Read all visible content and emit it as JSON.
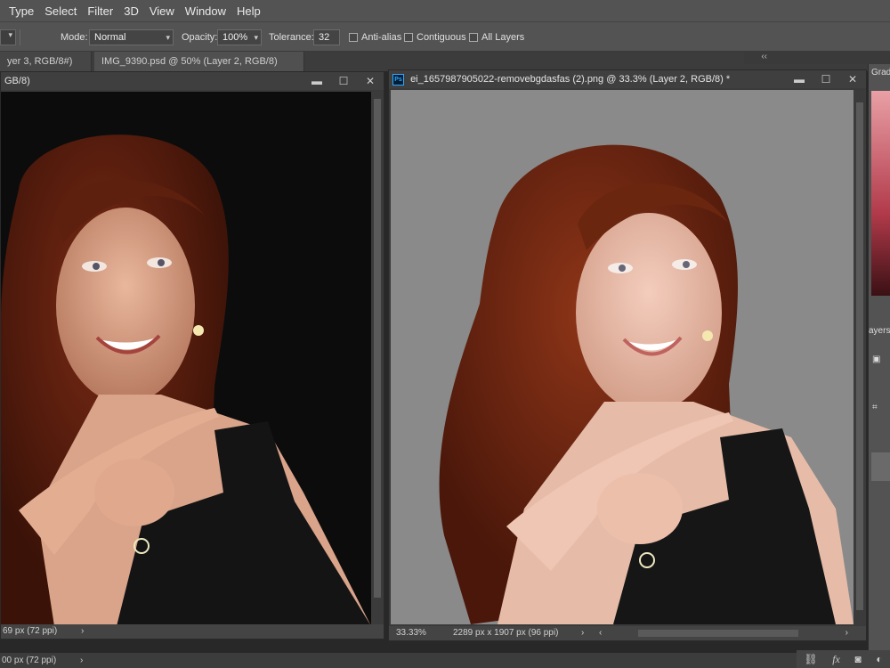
{
  "menu": [
    "Type",
    "Select",
    "Filter",
    "3D",
    "View",
    "Window",
    "Help"
  ],
  "options": {
    "mode_label": "Mode:",
    "mode_value": "Normal",
    "opacity_label": "Opacity:",
    "opacity_value": "100%",
    "tolerance_label": "Tolerance:",
    "tolerance_value": "32",
    "antialias": "Anti-alias",
    "contiguous": "Contiguous",
    "all_layers": "All Layers"
  },
  "tabs": [
    {
      "label": "yer 3, RGB/8#) *"
    },
    {
      "label": "IMG_9390.psd @ 50% (Layer 2, RGB/8) *"
    }
  ],
  "left_window": {
    "title": "GB/8)",
    "status": "69 px (72 ppi)"
  },
  "right_window": {
    "title": "ei_1657987905022-removebgdasfas (2).png @ 33.3% (Layer 2, RGB/8) *",
    "zoom": "33.33%",
    "status": "2289 px x 1907 px (96 ppi)"
  },
  "bottom_status": "00 px (72 ppi)",
  "panel": {
    "grad_label": "Grad",
    "layers_label": "ayers"
  },
  "colors": {
    "accent_ps": "#31a8ff",
    "ui_bg": "#535353",
    "right_canvas_bg": "#8a8a8a"
  },
  "icons": [
    "link-icon",
    "fx-icon",
    "mask-icon",
    "adjustment-icon"
  ]
}
